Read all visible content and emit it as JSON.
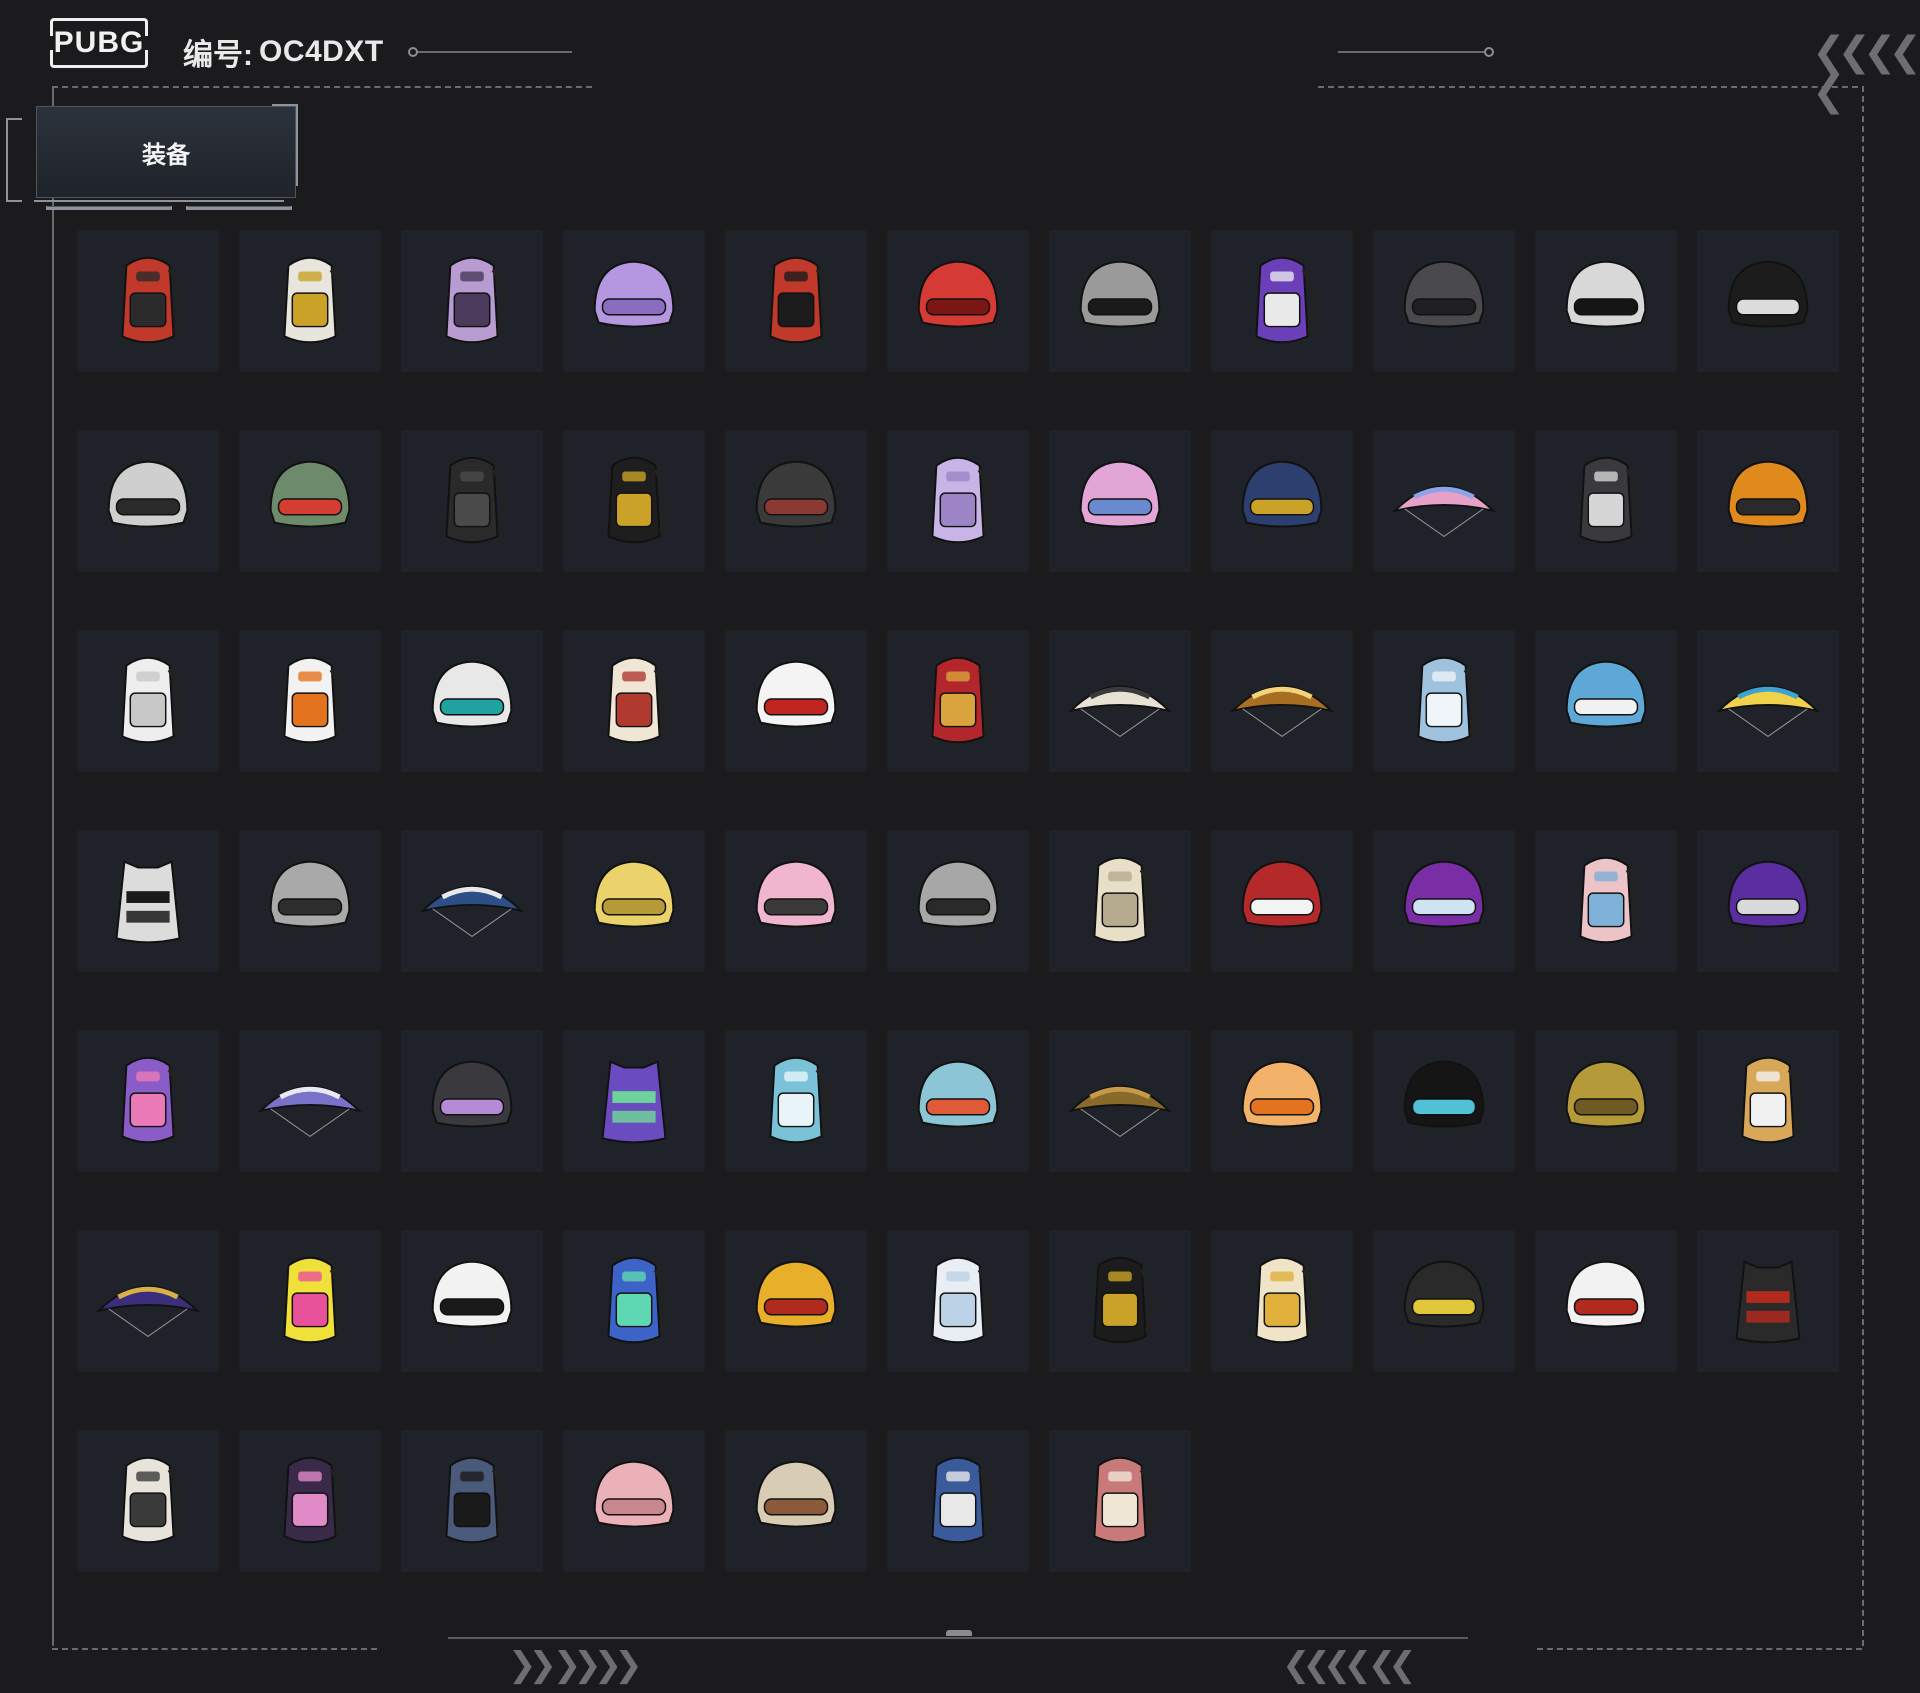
{
  "header": {
    "logo_text": "PUBG",
    "code_label": "编号:",
    "code_value": "OC4DXT"
  },
  "tab": {
    "label": "装备"
  },
  "colors": {
    "background": "#1b1b1d",
    "tile": "#1f2329",
    "frame": "#6b6b70"
  },
  "items": [
    {
      "type": "backpack",
      "primary": "#c0392b",
      "secondary": "#2b2b2b"
    },
    {
      "type": "backpack",
      "primary": "#e8e5dc",
      "secondary": "#c9a227"
    },
    {
      "type": "backpack",
      "primary": "#b79bd1",
      "secondary": "#4b3a5c"
    },
    {
      "type": "helmet",
      "primary": "#b497e0",
      "secondary": "#8a6cc0"
    },
    {
      "type": "backpack",
      "primary": "#c0392b",
      "secondary": "#1b1b1b"
    },
    {
      "type": "helmet",
      "primary": "#d63a35",
      "secondary": "#7a1714"
    },
    {
      "type": "helmet",
      "primary": "#9a9a9a",
      "secondary": "#1a1a1a"
    },
    {
      "type": "backpack",
      "primary": "#6b3fb8",
      "secondary": "#e9e9e9"
    },
    {
      "type": "helmet",
      "primary": "#4a4a4e",
      "secondary": "#202022"
    },
    {
      "type": "helmet",
      "primary": "#d8d8d8",
      "secondary": "#151515"
    },
    {
      "type": "helmet",
      "primary": "#1c1c1c",
      "secondary": "#dcdcdc"
    },
    {
      "type": "helmet",
      "primary": "#cfcfcf",
      "secondary": "#2a2a2a"
    },
    {
      "type": "helmet",
      "primary": "#6d8a6a",
      "secondary": "#d43d2f"
    },
    {
      "type": "backpack",
      "primary": "#2a2a2a",
      "secondary": "#4a4a4a"
    },
    {
      "type": "backpack",
      "primary": "#1e1e1e",
      "secondary": "#c9a227"
    },
    {
      "type": "helmet",
      "primary": "#3a3a3a",
      "secondary": "#8a3a33"
    },
    {
      "type": "backpack",
      "primary": "#c8b4e6",
      "secondary": "#9d84c7"
    },
    {
      "type": "helmet",
      "primary": "#e2a6d6",
      "secondary": "#6a8ad0"
    },
    {
      "type": "helmet",
      "primary": "#2c3f6e",
      "secondary": "#c9a227"
    },
    {
      "type": "parachute",
      "primary": "#e6a1c8",
      "secondary": "#8da2e8"
    },
    {
      "type": "backpack",
      "primary": "#3a3a3e",
      "secondary": "#d6d6d6"
    },
    {
      "type": "helmet",
      "primary": "#e08a1e",
      "secondary": "#2a2a2a"
    },
    {
      "type": "backpack",
      "primary": "#eeeeee",
      "secondary": "#c8c8c8"
    },
    {
      "type": "backpack",
      "primary": "#f2f2f2",
      "secondary": "#e3731e"
    },
    {
      "type": "helmet",
      "primary": "#e8e8e8",
      "secondary": "#20a3a0"
    },
    {
      "type": "backpack",
      "primary": "#efe6d6",
      "secondary": "#b03a2e"
    },
    {
      "type": "helmet",
      "primary": "#f4f4f4",
      "secondary": "#c0261f"
    },
    {
      "type": "backpack",
      "primary": "#b3262b",
      "secondary": "#d9a43d"
    },
    {
      "type": "parachute",
      "primary": "#e8e2d4",
      "secondary": "#3a3a3a"
    },
    {
      "type": "parachute",
      "primary": "#a86e22",
      "secondary": "#f2d27a"
    },
    {
      "type": "backpack",
      "primary": "#9fc2de",
      "secondary": "#eef4f8"
    },
    {
      "type": "helmet",
      "primary": "#5ea8d8",
      "secondary": "#f1f1f1"
    },
    {
      "type": "parachute",
      "primary": "#f0d24a",
      "secondary": "#3da3d4"
    },
    {
      "type": "vest",
      "primary": "#dcdcdc",
      "secondary": "#1a1a1a"
    },
    {
      "type": "helmet",
      "primary": "#a9a9a9",
      "secondary": "#2d2d2d"
    },
    {
      "type": "parachute",
      "primary": "#2c4f86",
      "secondary": "#e8e8e8"
    },
    {
      "type": "helmet",
      "primary": "#ecd26a",
      "secondary": "#b69a36"
    },
    {
      "type": "helmet",
      "primary": "#f0b6cf",
      "secondary": "#3a3a3a"
    },
    {
      "type": "helmet",
      "primary": "#a7a7a7",
      "secondary": "#2a2a2a"
    },
    {
      "type": "backpack",
      "primary": "#e8dfc8",
      "secondary": "#b7ab8f"
    },
    {
      "type": "helmet",
      "primary": "#b42a2a",
      "secondary": "#f3f3f3"
    },
    {
      "type": "helmet",
      "primary": "#7a2ea6",
      "secondary": "#cfe3f0"
    },
    {
      "type": "backpack",
      "primary": "#ecc4c8",
      "secondary": "#7fb0d8"
    },
    {
      "type": "helmet",
      "primary": "#5b2ea0",
      "secondary": "#d9d9d9"
    },
    {
      "type": "backpack",
      "primary": "#8a5cc8",
      "secondary": "#ea7ab8"
    },
    {
      "type": "parachute",
      "primary": "#7a72c8",
      "secondary": "#e8e8f4"
    },
    {
      "type": "helmet",
      "primary": "#3a3a3e",
      "secondary": "#b58bd8"
    },
    {
      "type": "vest",
      "primary": "#6a4bc0",
      "secondary": "#6ed39a"
    },
    {
      "type": "backpack",
      "primary": "#7ac2d8",
      "secondary": "#e8f4f8"
    },
    {
      "type": "helmet",
      "primary": "#8cc6d6",
      "secondary": "#e05a3a"
    },
    {
      "type": "parachute",
      "primary": "#8a6a2a",
      "secondary": "#c79a4a"
    },
    {
      "type": "helmet",
      "primary": "#f2b26a",
      "secondary": "#e3731e"
    },
    {
      "type": "helmet",
      "primary": "#151515",
      "secondary": "#52c2d8"
    },
    {
      "type": "helmet",
      "primary": "#b59a3a",
      "secondary": "#6e5a22"
    },
    {
      "type": "backpack",
      "primary": "#d8a85a",
      "secondary": "#f1f1f1"
    },
    {
      "type": "parachute",
      "primary": "#3b2e7a",
      "secondary": "#d8b04a"
    },
    {
      "type": "backpack",
      "primary": "#f0e03a",
      "secondary": "#e8529a"
    },
    {
      "type": "helmet",
      "primary": "#f2f2f2",
      "secondary": "#1a1a1a"
    },
    {
      "type": "backpack",
      "primary": "#3e63c8",
      "secondary": "#5ed8b2"
    },
    {
      "type": "helmet",
      "primary": "#e8b02a",
      "secondary": "#b02a1e"
    },
    {
      "type": "backpack",
      "primary": "#e8eef4",
      "secondary": "#bcd2e6"
    },
    {
      "type": "backpack",
      "primary": "#1c1c1c",
      "secondary": "#c9a227"
    },
    {
      "type": "backpack",
      "primary": "#f0e4c8",
      "secondary": "#e0b03a"
    },
    {
      "type": "helmet",
      "primary": "#2a2a2a",
      "secondary": "#e0c83a"
    },
    {
      "type": "helmet",
      "primary": "#f2f2f2",
      "secondary": "#b02a1e"
    },
    {
      "type": "vest",
      "primary": "#2a2a2a",
      "secondary": "#b02a1e"
    },
    {
      "type": "backpack",
      "primary": "#e8e4dc",
      "secondary": "#3a3a3a"
    },
    {
      "type": "backpack",
      "primary": "#3a2a4a",
      "secondary": "#e08ac8"
    },
    {
      "type": "backpack",
      "primary": "#4a5a7a",
      "secondary": "#1a1a1a"
    },
    {
      "type": "helmet",
      "primary": "#eab2b8",
      "secondary": "#c8868e"
    },
    {
      "type": "helmet",
      "primary": "#d8cdb4",
      "secondary": "#8a5a3a"
    },
    {
      "type": "backpack",
      "primary": "#3a5a9a",
      "secondary": "#e8e8e8"
    },
    {
      "type": "backpack",
      "primary": "#c87a7a",
      "secondary": "#efe6d6"
    }
  ]
}
